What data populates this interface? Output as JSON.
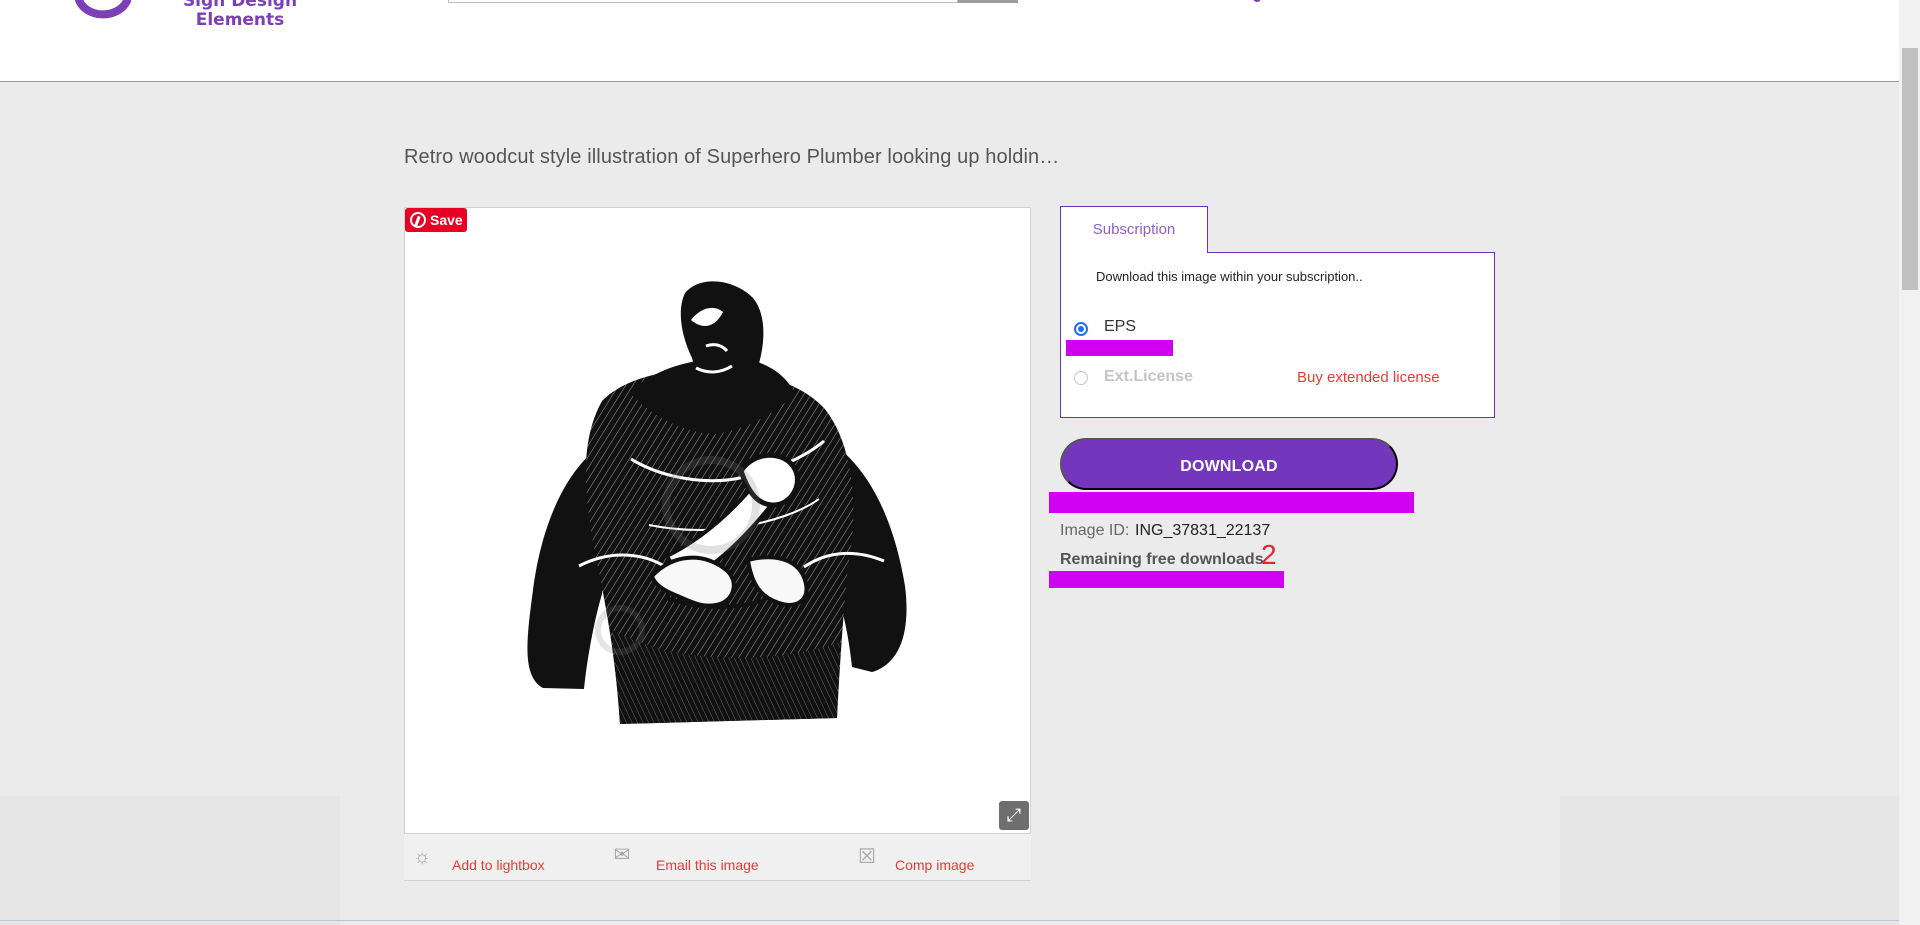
{
  "header": {
    "logo_text": "Sign Design Elements"
  },
  "product": {
    "title": "Retro woodcut style illustration of Superhero Plumber looking up holdin…",
    "pinterest_save": "Save",
    "toolbar": {
      "add_to_lightbox": "Add to lightbox",
      "email_image": "Email this image",
      "comp_image": "Comp image"
    }
  },
  "purchase": {
    "tab_label": "Subscription",
    "intro": "Download this image within your subscription..",
    "format_option": "EPS",
    "extended_option": "Ext.License",
    "buy_extended": "Buy extended license",
    "download_label": "DOWNLOAD",
    "image_id_label": "Image ID:",
    "image_id": "ING_37831_22137",
    "remaining_label": "Remaining free downloads",
    "remaining_count": "2"
  },
  "icons": [
    "logo-mark-icon",
    "pinterest-icon",
    "expand-icon",
    "lightbulb-icon",
    "envelope-icon",
    "comp-image-icon"
  ],
  "colors": {
    "brand_purple": "#7436bd",
    "link_red": "#e43d33",
    "highlight_magenta": "#d000f0"
  }
}
